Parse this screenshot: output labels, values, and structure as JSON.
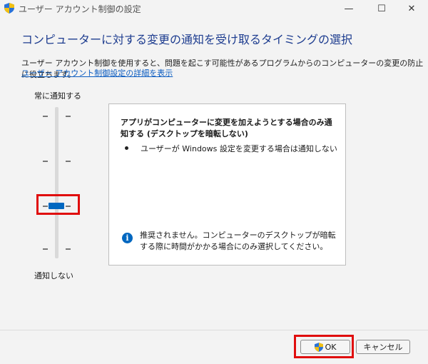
{
  "window": {
    "title": "ユーザー アカウント制御の設定",
    "minimize_icon": "minimize-icon",
    "maximize_icon": "maximize-icon",
    "close_icon": "close-icon"
  },
  "heading": "コンピューターに対する変更の通知を受け取るタイミングの選択",
  "description": "ユーザー アカウント制御を使用すると、問題を起こす可能性があるプログラムからのコンピューターの変更の防止に役立ちます。",
  "link": "ユーザー アカウント制御設定の詳細を表示",
  "slider": {
    "top_label": "常に通知する",
    "bottom_label": "通知しない",
    "levels": 4,
    "selected_level": 2
  },
  "info": {
    "title": "アプリがコンピューターに変更を加えようとする場合のみ通知する (デスクトップを暗転しない)",
    "bullet": "ユーザーが Windows 設定を変更する場合は通知しない",
    "note": "推奨されません。コンピューターのデスクトップが暗転する際に時間がかかる場合にのみ選択してください。"
  },
  "buttons": {
    "ok": "OK",
    "cancel": "キャンセル"
  },
  "colors": {
    "accent": "#0067c0",
    "heading": "#1d3c8f",
    "highlight": "#e00d0d"
  }
}
